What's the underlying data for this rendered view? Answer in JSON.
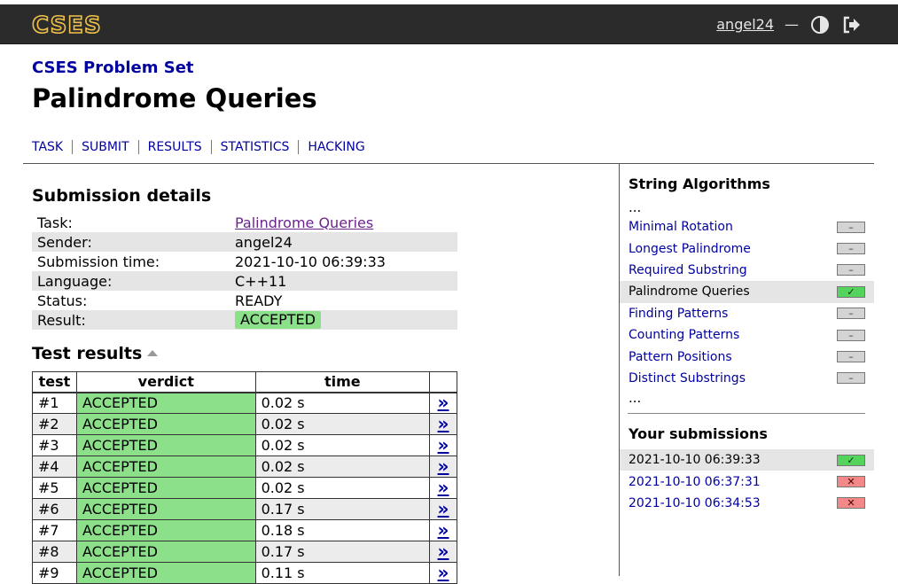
{
  "header": {
    "logo_text": "CSES",
    "username": "angel24",
    "separator": "—",
    "theme_icon": "half-circle-icon",
    "logout_icon": "logout-icon",
    "brand_color": "#f0c14b"
  },
  "breadcrumb": "CSES Problem Set",
  "page_title": "Palindrome Queries",
  "tabs": [
    "TASK",
    "SUBMIT",
    "RESULTS",
    "STATISTICS",
    "HACKING"
  ],
  "submission": {
    "heading": "Submission details",
    "rows": [
      {
        "label": "Task:",
        "value": "Palindrome Queries"
      },
      {
        "label": "Sender:",
        "value": "angel24"
      },
      {
        "label": "Submission time:",
        "value": "2021-10-10 06:39:33"
      },
      {
        "label": "Language:",
        "value": "C++11"
      },
      {
        "label": "Status:",
        "value": "READY"
      },
      {
        "label": "Result:",
        "value": "ACCEPTED"
      }
    ]
  },
  "tests": {
    "heading": "Test results",
    "columns": [
      "test",
      "verdict",
      "time",
      ""
    ],
    "link_glyph": "»",
    "rows": [
      {
        "test": "#1",
        "verdict": "ACCEPTED",
        "time": "0.02 s"
      },
      {
        "test": "#2",
        "verdict": "ACCEPTED",
        "time": "0.02 s"
      },
      {
        "test": "#3",
        "verdict": "ACCEPTED",
        "time": "0.02 s"
      },
      {
        "test": "#4",
        "verdict": "ACCEPTED",
        "time": "0.02 s"
      },
      {
        "test": "#5",
        "verdict": "ACCEPTED",
        "time": "0.02 s"
      },
      {
        "test": "#6",
        "verdict": "ACCEPTED",
        "time": "0.17 s"
      },
      {
        "test": "#7",
        "verdict": "ACCEPTED",
        "time": "0.18 s"
      },
      {
        "test": "#8",
        "verdict": "ACCEPTED",
        "time": "0.17 s"
      },
      {
        "test": "#9",
        "verdict": "ACCEPTED",
        "time": "0.11 s"
      }
    ]
  },
  "sidebar": {
    "section_title": "String Algorithms",
    "ellipsis": "...",
    "tasks": [
      {
        "name": "Minimal Rotation",
        "status": "–",
        "state": "none"
      },
      {
        "name": "Longest Palindrome",
        "status": "–",
        "state": "none"
      },
      {
        "name": "Required Substring",
        "status": "–",
        "state": "none"
      },
      {
        "name": "Palindrome Queries",
        "status": "✓",
        "state": "ok",
        "current": true
      },
      {
        "name": "Finding Patterns",
        "status": "–",
        "state": "none"
      },
      {
        "name": "Counting Patterns",
        "status": "–",
        "state": "none"
      },
      {
        "name": "Pattern Positions",
        "status": "–",
        "state": "none"
      },
      {
        "name": "Distinct Substrings",
        "status": "–",
        "state": "none"
      }
    ],
    "submissions_title": "Your submissions",
    "submissions": [
      {
        "time": "2021-10-10 06:39:33",
        "status": "✓",
        "state": "ok",
        "current": true
      },
      {
        "time": "2021-10-10 06:37:31",
        "status": "✕",
        "state": "bad"
      },
      {
        "time": "2021-10-10 06:34:53",
        "status": "✕",
        "state": "bad"
      }
    ]
  }
}
